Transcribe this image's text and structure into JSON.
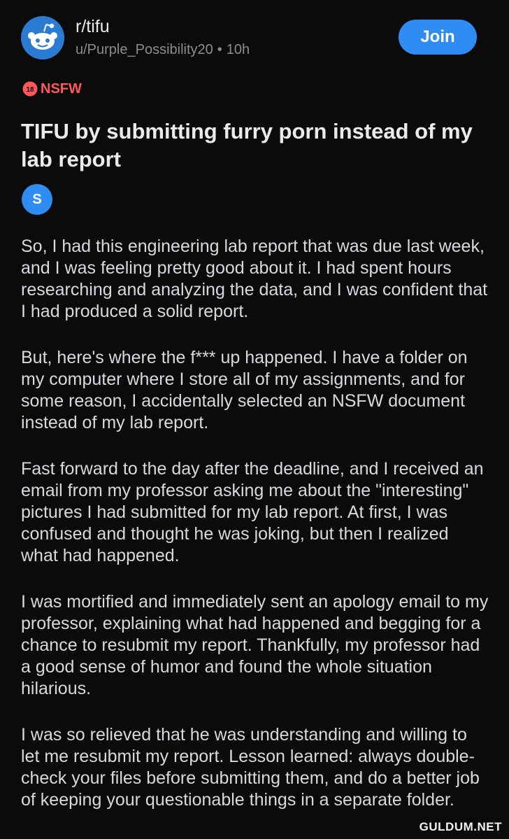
{
  "header": {
    "subreddit": "r/tifu",
    "author": "u/Purple_Possibility20",
    "separator": "•",
    "time": "10h",
    "join_label": "Join",
    "avatar_icon": "reddit-snoo-icon"
  },
  "nsfw": {
    "badge_number": "18",
    "label": "NSFW",
    "icon": "nsfw-18-icon"
  },
  "post": {
    "title": "TIFU by submitting furry porn instead of my lab report",
    "flair": "S",
    "paragraphs": [
      "So, I had this engineering lab report that was due last week, and I was feeling pretty good about it. I had spent hours researching and analyzing the data, and I was confident that I had produced a solid report.",
      "But, here's where the f*** up happened. I have a folder on my computer where I store all of my assignments, and for some reason, I accidentally selected an NSFW document instead of my lab report.",
      "Fast forward to the day after the deadline, and I received an email from my professor asking me about the \"interesting\" pictures I had submitted for my lab report. At first, I was confused and thought he was joking, but then I realized what had happened.",
      "I was mortified and immediately sent an apology email to my professor, explaining what had happened and begging for a chance to resubmit my report. Thankfully, my professor had a good sense of humor and found the whole situation hilarious.",
      "I was so relieved that he was understanding and willing to let me resubmit my report. Lesson learned: always double-check your files before submitting them, and do a better job of keeping your questionable things in a separate folder."
    ]
  },
  "watermark": "GULDUM.NET",
  "colors": {
    "background": "#0b0b0c",
    "accent_blue": "#2f8cf3",
    "nsfw_red": "#ff585b",
    "text": "#d7dadc",
    "muted": "#8a8d91"
  }
}
